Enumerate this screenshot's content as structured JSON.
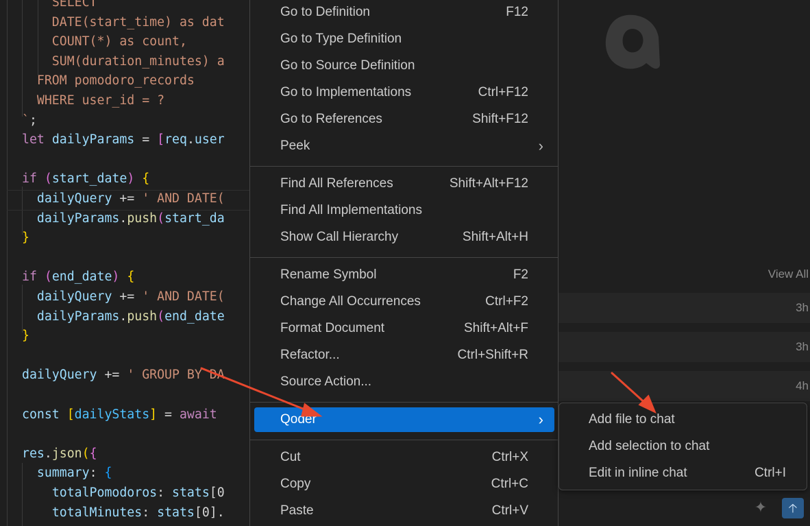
{
  "editor": {
    "lines": [
      [
        {
          "t": "    ",
          "c": "pl"
        },
        {
          "t": "SELECT",
          "c": "st"
        },
        {
          "t": " ",
          "c": "pl"
        }
      ],
      [
        {
          "t": "    DATE(start_time) as dat",
          "c": "st"
        }
      ],
      [
        {
          "t": "    COUNT(*) as count,",
          "c": "st"
        }
      ],
      [
        {
          "t": "    SUM(duration_minutes) a",
          "c": "st"
        }
      ],
      [
        {
          "t": "  FROM pomodoro_records",
          "c": "st"
        }
      ],
      [
        {
          "t": "  WHERE user_id = ?",
          "c": "st"
        }
      ],
      [
        {
          "t": "`",
          "c": "st"
        },
        {
          "t": ";",
          "c": "pl"
        }
      ],
      [
        {
          "t": "let",
          "c": "kw"
        },
        {
          "t": " ",
          "c": "pl"
        },
        {
          "t": "dailyParams",
          "c": "var"
        },
        {
          "t": " = ",
          "c": "pl"
        },
        {
          "t": "[",
          "c": "b2"
        },
        {
          "t": "req",
          "c": "var"
        },
        {
          "t": ".",
          "c": "pl"
        },
        {
          "t": "user",
          "c": "var"
        }
      ],
      [],
      [
        {
          "t": "if",
          "c": "kw"
        },
        {
          "t": " ",
          "c": "pl"
        },
        {
          "t": "(",
          "c": "b2"
        },
        {
          "t": "start_date",
          "c": "var"
        },
        {
          "t": ")",
          "c": "b2"
        },
        {
          "t": " ",
          "c": "pl"
        },
        {
          "t": "{",
          "c": "b1"
        }
      ],
      [
        {
          "t": "  ",
          "c": "pl"
        },
        {
          "t": "dailyQuery",
          "c": "var"
        },
        {
          "t": " += ",
          "c": "pl"
        },
        {
          "t": "' AND DATE(",
          "c": "st"
        }
      ],
      [
        {
          "t": "  ",
          "c": "pl"
        },
        {
          "t": "dailyParams",
          "c": "var"
        },
        {
          "t": ".",
          "c": "pl"
        },
        {
          "t": "push",
          "c": "fn"
        },
        {
          "t": "(",
          "c": "b2"
        },
        {
          "t": "start_da",
          "c": "var"
        }
      ],
      [
        {
          "t": "}",
          "c": "b1"
        }
      ],
      [],
      [
        {
          "t": "if",
          "c": "kw"
        },
        {
          "t": " ",
          "c": "pl"
        },
        {
          "t": "(",
          "c": "b2"
        },
        {
          "t": "end_date",
          "c": "var"
        },
        {
          "t": ")",
          "c": "b2"
        },
        {
          "t": " ",
          "c": "pl"
        },
        {
          "t": "{",
          "c": "b1"
        }
      ],
      [
        {
          "t": "  ",
          "c": "pl"
        },
        {
          "t": "dailyQuery",
          "c": "var"
        },
        {
          "t": " += ",
          "c": "pl"
        },
        {
          "t": "' AND DATE(",
          "c": "st"
        }
      ],
      [
        {
          "t": "  ",
          "c": "pl"
        },
        {
          "t": "dailyParams",
          "c": "var"
        },
        {
          "t": ".",
          "c": "pl"
        },
        {
          "t": "push",
          "c": "fn"
        },
        {
          "t": "(",
          "c": "b2"
        },
        {
          "t": "end_date",
          "c": "var"
        }
      ],
      [
        {
          "t": "}",
          "c": "b1"
        }
      ],
      [],
      [
        {
          "t": "dailyQuery",
          "c": "var"
        },
        {
          "t": " += ",
          "c": "pl"
        },
        {
          "t": "' GROUP BY DA",
          "c": "st"
        }
      ],
      [],
      [
        {
          "t": "const",
          "c": "var"
        },
        {
          "t": " ",
          "c": "pl"
        },
        {
          "t": "[",
          "c": "b1"
        },
        {
          "t": "dailyStats",
          "c": "cst"
        },
        {
          "t": "]",
          "c": "b1"
        },
        {
          "t": " = ",
          "c": "pl"
        },
        {
          "t": "await",
          "c": "kw"
        }
      ],
      [],
      [
        {
          "t": "res",
          "c": "var"
        },
        {
          "t": ".",
          "c": "pl"
        },
        {
          "t": "json",
          "c": "fn"
        },
        {
          "t": "(",
          "c": "b1"
        },
        {
          "t": "{",
          "c": "b2"
        }
      ],
      [
        {
          "t": "  ",
          "c": "pl"
        },
        {
          "t": "summary",
          "c": "var"
        },
        {
          "t": ": ",
          "c": "pl"
        },
        {
          "t": "{",
          "c": "b3"
        }
      ],
      [
        {
          "t": "    ",
          "c": "pl"
        },
        {
          "t": "totalPomodoros",
          "c": "var"
        },
        {
          "t": ": ",
          "c": "pl"
        },
        {
          "t": "stats",
          "c": "var"
        },
        {
          "t": "[0",
          "c": "pl"
        }
      ],
      [
        {
          "t": "    ",
          "c": "pl"
        },
        {
          "t": "totalMinutes",
          "c": "var"
        },
        {
          "t": ": ",
          "c": "pl"
        },
        {
          "t": "stats",
          "c": "var"
        },
        {
          "t": "[0].",
          "c": "pl"
        }
      ]
    ]
  },
  "context_menu": {
    "groups": [
      [
        {
          "label": "Go to Definition",
          "shortcut": "F12"
        },
        {
          "label": "Go to Type Definition",
          "shortcut": ""
        },
        {
          "label": "Go to Source Definition",
          "shortcut": ""
        },
        {
          "label": "Go to Implementations",
          "shortcut": "Ctrl+F12"
        },
        {
          "label": "Go to References",
          "shortcut": "Shift+F12"
        },
        {
          "label": "Peek",
          "shortcut": "",
          "submenu": true
        }
      ],
      [
        {
          "label": "Find All References",
          "shortcut": "Shift+Alt+F12"
        },
        {
          "label": "Find All Implementations",
          "shortcut": ""
        },
        {
          "label": "Show Call Hierarchy",
          "shortcut": "Shift+Alt+H"
        }
      ],
      [
        {
          "label": "Rename Symbol",
          "shortcut": "F2"
        },
        {
          "label": "Change All Occurrences",
          "shortcut": "Ctrl+F2"
        },
        {
          "label": "Format Document",
          "shortcut": "Shift+Alt+F"
        },
        {
          "label": "Refactor...",
          "shortcut": "Ctrl+Shift+R"
        },
        {
          "label": "Source Action...",
          "shortcut": ""
        }
      ],
      [
        {
          "label": "Qoder",
          "shortcut": "",
          "submenu": true,
          "active": true
        }
      ],
      [
        {
          "label": "Cut",
          "shortcut": "Ctrl+X"
        },
        {
          "label": "Copy",
          "shortcut": "Ctrl+C"
        },
        {
          "label": "Paste",
          "shortcut": "Ctrl+V"
        }
      ]
    ]
  },
  "submenu": {
    "items": [
      {
        "label": "Add file to chat",
        "shortcut": ""
      },
      {
        "label": "Add selection to chat",
        "shortcut": ""
      },
      {
        "label": "Edit in inline chat",
        "shortcut": "Ctrl+I"
      }
    ]
  },
  "panel": {
    "view_all": "View All",
    "history_times": [
      "3h",
      "3h",
      "4h"
    ]
  },
  "colors": {
    "accent": "#0b6fd0",
    "annotation_arrow": "#e8482e"
  },
  "icons": {
    "chevron": "chevron-right-icon",
    "sparkle": "sparkle-icon",
    "send": "send-arrow-up-icon",
    "logo": "qoder-logo-icon"
  }
}
